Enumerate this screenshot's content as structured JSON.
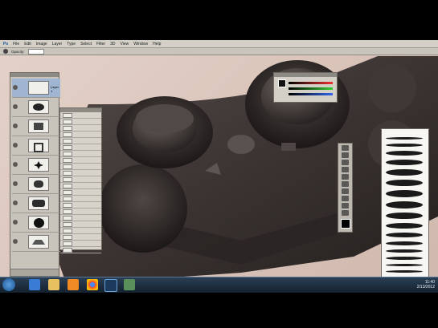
{
  "menu": {
    "items": [
      "Ps",
      "File",
      "Edit",
      "Image",
      "Layer",
      "Type",
      "Select",
      "Filter",
      "3D",
      "View",
      "Window",
      "Help"
    ]
  },
  "options": {
    "label": "Opacity:"
  },
  "colors": {
    "accent": "#d9c3b9",
    "controller": "#3a3432",
    "panel": "#c8c4bc"
  },
  "icons": [
    "brush-icon",
    "eye-icon",
    "move-icon",
    "eraser-icon"
  ],
  "layers": [
    {
      "name": "Layer 1"
    },
    {
      "name": ""
    },
    {
      "name": ""
    },
    {
      "name": ""
    },
    {
      "name": ""
    },
    {
      "name": ""
    },
    {
      "name": ""
    },
    {
      "name": ""
    }
  ],
  "clock": {
    "time": "11:40",
    "date": "2/13/2012"
  }
}
